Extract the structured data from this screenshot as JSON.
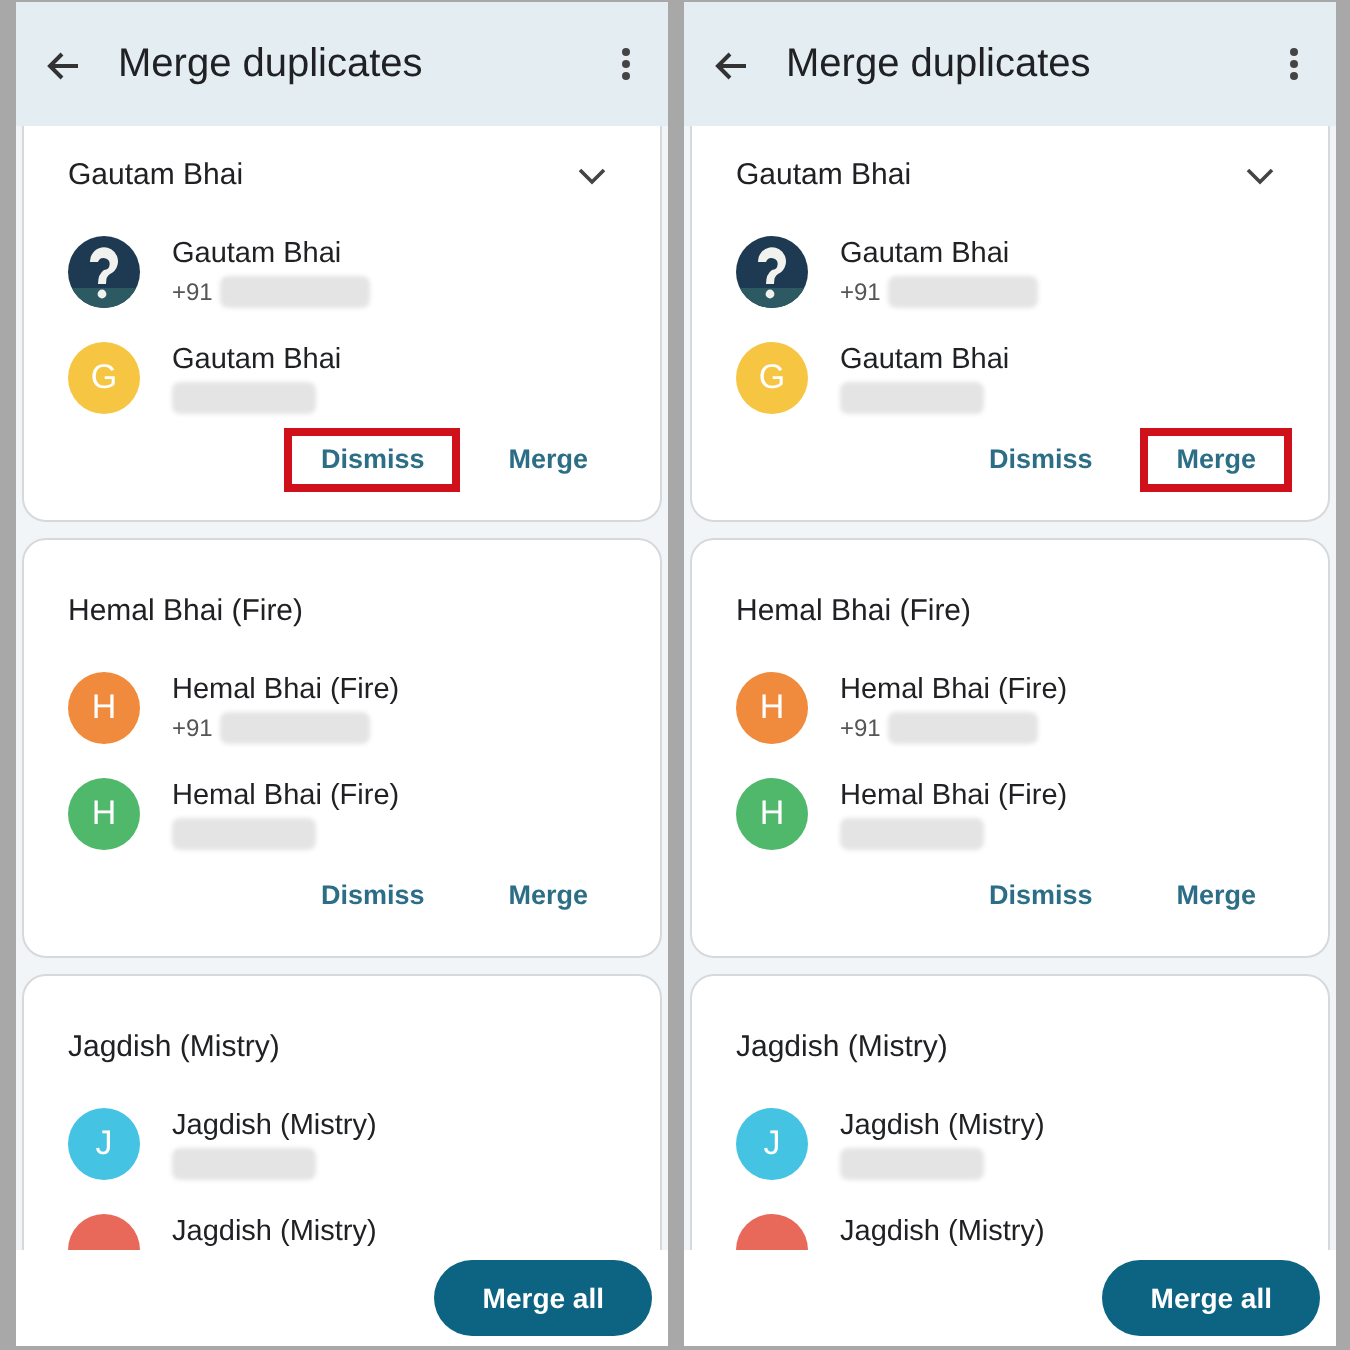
{
  "panels": [
    {
      "title": "Merge duplicates",
      "groups": [
        {
          "title": "Gautam Bhai",
          "expanded": false,
          "contacts": [
            {
              "name": "Gautam Bhai",
              "phone_prefix": "+91",
              "redacted_number": true
            },
            {
              "name": "Gautam Bhai",
              "avatar": {
                "kind": "letter",
                "letter": "G",
                "color": "#f6c642"
              },
              "redacted_number": true
            }
          ],
          "actions": [
            {
              "label": "Dismiss",
              "highlighted": true
            },
            {
              "label": "Merge",
              "highlighted": false
            }
          ]
        },
        {
          "title": "Hemal Bhai (Fire)",
          "contacts": [
            {
              "name": "Hemal Bhai (Fire)",
              "avatar": {
                "kind": "letter",
                "letter": "H",
                "color": "#f08a3c"
              },
              "phone_prefix": "+91",
              "redacted_number": true
            },
            {
              "name": "Hemal Bhai (Fire)",
              "avatar": {
                "kind": "letter",
                "letter": "H",
                "color": "#4fb86a"
              },
              "redacted_number": true
            }
          ],
          "actions": [
            "Dismiss",
            "Merge"
          ]
        },
        {
          "title": "Jagdish (Mistry)",
          "contacts": [
            {
              "name": "Jagdish (Mistry)",
              "avatar": {
                "kind": "letter",
                "letter": "J",
                "color": "#45c3e3"
              },
              "redacted_number": true
            },
            {
              "name": "Jagdish (Mistry)",
              "avatar": {
                "kind": "letter",
                "color": "#e8685a"
              }
            }
          ]
        }
      ],
      "merge_all": "Merge all"
    },
    {
      "title": "Merge duplicates",
      "groups": [
        {
          "title": "Gautam Bhai",
          "expanded": false,
          "contacts": [
            {
              "name": "Gautam Bhai",
              "phone_prefix": "+91",
              "redacted_number": true
            },
            {
              "name": "Gautam Bhai",
              "avatar": {
                "kind": "letter",
                "letter": "G",
                "color": "#f6c642"
              },
              "redacted_number": true
            }
          ],
          "actions": [
            {
              "label": "Dismiss",
              "highlighted": false
            },
            {
              "label": "Merge",
              "highlighted": true
            }
          ]
        },
        {
          "title": "Hemal Bhai (Fire)",
          "contacts": [
            {
              "name": "Hemal Bhai (Fire)",
              "avatar": {
                "kind": "letter",
                "letter": "H",
                "color": "#f08a3c"
              },
              "phone_prefix": "+91",
              "redacted_number": true
            },
            {
              "name": "Hemal Bhai (Fire)",
              "avatar": {
                "kind": "letter",
                "letter": "H",
                "color": "#4fb86a"
              },
              "redacted_number": true
            }
          ],
          "actions": [
            "Dismiss",
            "Merge"
          ]
        },
        {
          "title": "Jagdish (Mistry)",
          "contacts": [
            {
              "name": "Jagdish (Mistry)",
              "avatar": {
                "kind": "letter",
                "letter": "J",
                "color": "#45c3e3"
              },
              "redacted_number": true
            },
            {
              "name": "Jagdish (Mistry)",
              "avatar": {
                "kind": "letter",
                "color": "#e8685a"
              }
            }
          ]
        }
      ],
      "merge_all": "Merge all"
    }
  ]
}
